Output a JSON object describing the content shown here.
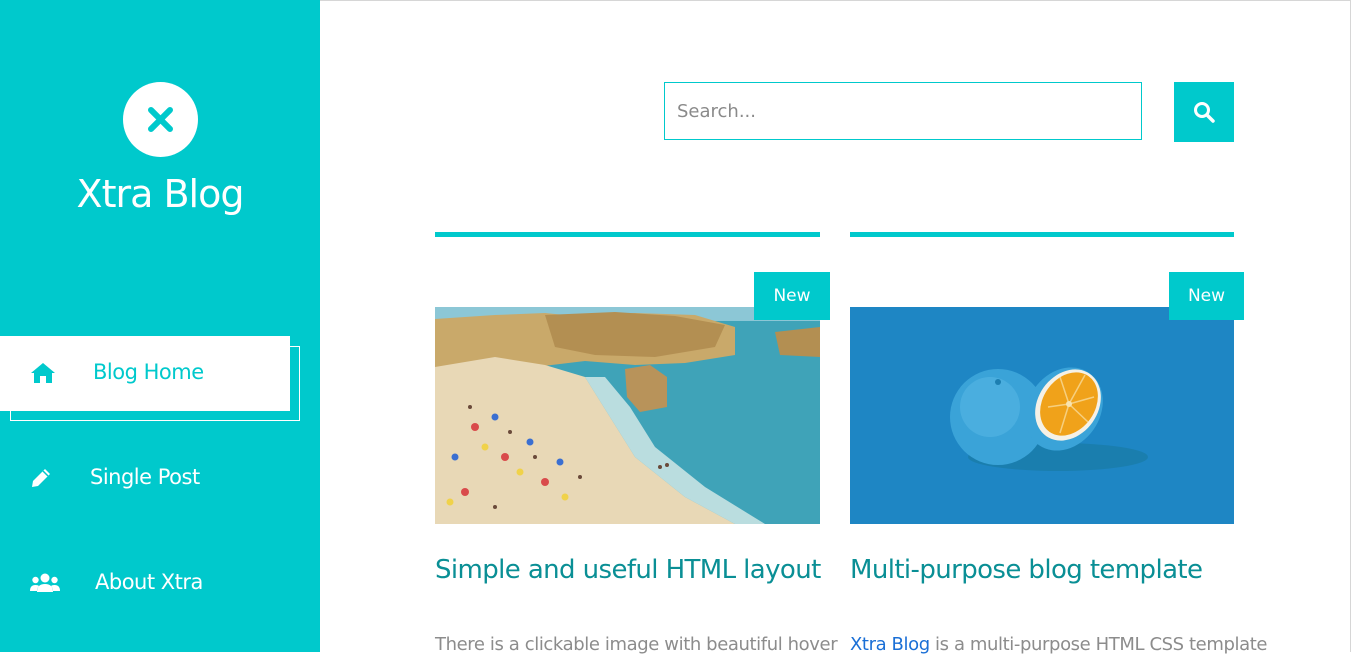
{
  "sidebar": {
    "brand": "Xtra Blog",
    "logo_icon": "close-x-icon",
    "nav": [
      {
        "label": "Blog Home",
        "icon": "home-icon",
        "active": true
      },
      {
        "label": "Single Post",
        "icon": "pencil-icon",
        "active": false
      },
      {
        "label": "About Xtra",
        "icon": "users-icon",
        "active": false
      }
    ]
  },
  "search": {
    "placeholder": "Search...",
    "button_icon": "search-icon"
  },
  "posts": [
    {
      "badge": "New",
      "image": "beach-coast-photo",
      "title": "Simple and useful HTML layout",
      "excerpt": "There is a clickable image with beautiful hover"
    },
    {
      "badge": "New",
      "image": "blue-orange-photo",
      "title": "Multi-purpose blog template",
      "excerpt_link": "Xtra Blog",
      "excerpt_rest": " is a multi-purpose HTML CSS template"
    }
  ],
  "colors": {
    "accent": "#00c9cc",
    "title": "#0a8f95",
    "link": "#1a6fd6"
  }
}
